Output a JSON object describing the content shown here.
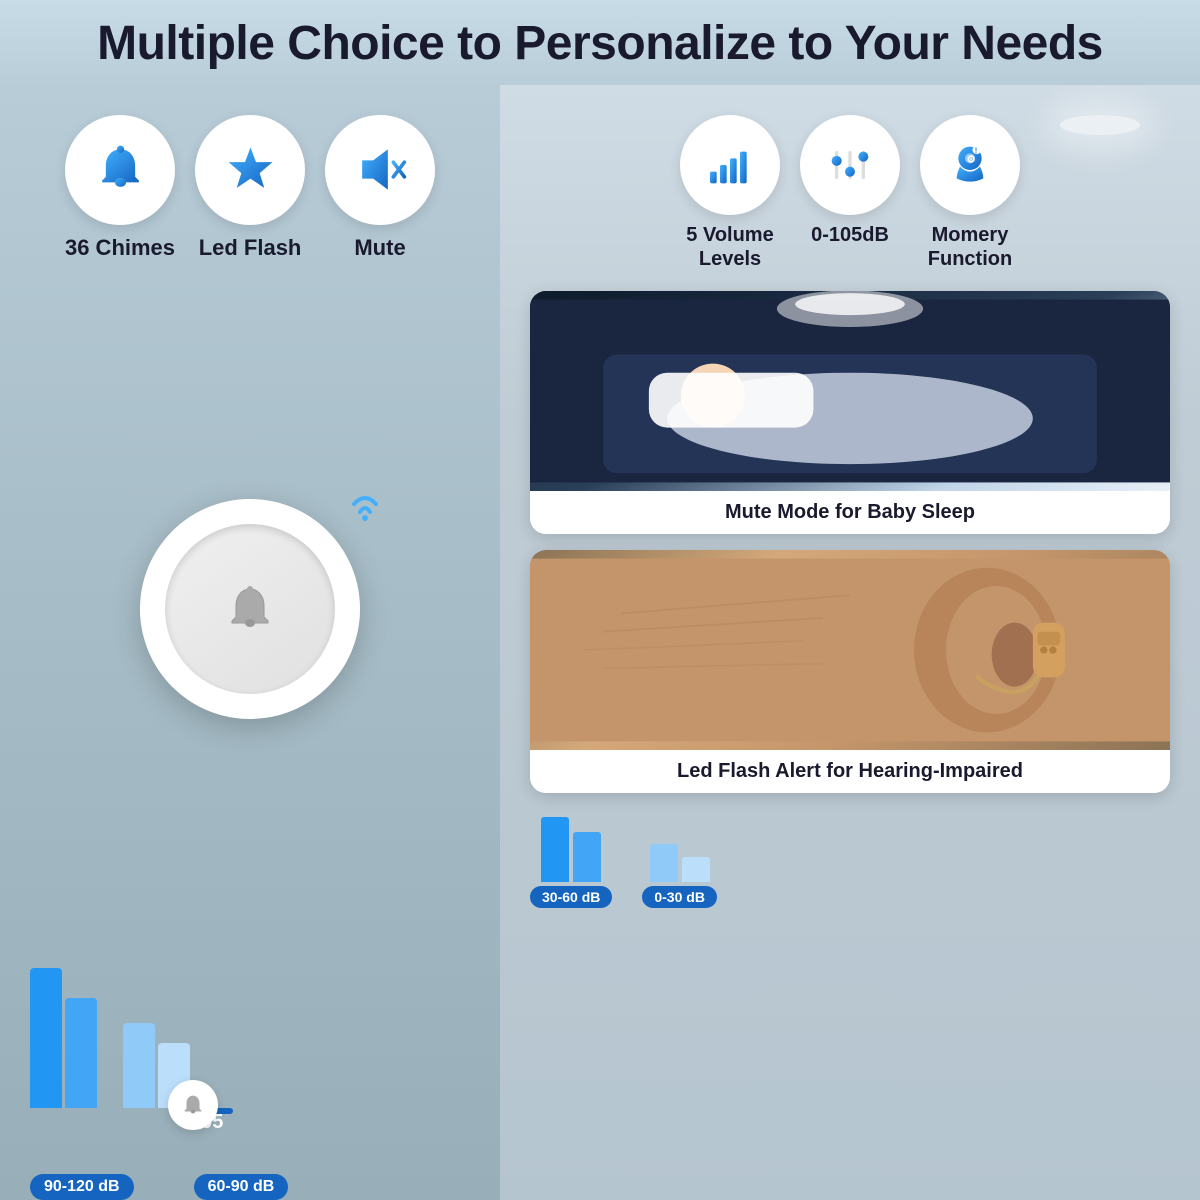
{
  "header": {
    "title": "Multiple Choice to Personalize to Your Needs"
  },
  "left_features": [
    {
      "id": "chimes",
      "label": "36 Chimes",
      "icon": "bell"
    },
    {
      "id": "led_flash",
      "label": "Led Flash",
      "icon": "star"
    },
    {
      "id": "mute",
      "label": "Mute",
      "icon": "mute"
    }
  ],
  "right_features": [
    {
      "id": "volume",
      "label": "5 Volume\nLevels",
      "icon": "bars"
    },
    {
      "id": "db",
      "label": "0-105dB",
      "icon": "equalizer"
    },
    {
      "id": "memory",
      "label": "Momery\nFunction",
      "icon": "head"
    }
  ],
  "db_badge": "105",
  "cards": [
    {
      "id": "baby",
      "label": "Mute Mode for Baby Sleep"
    },
    {
      "id": "ear",
      "label": "Led Flash Alert for Hearing-Impaired"
    }
  ],
  "volume_ranges_left": [
    {
      "label": "90-120 dB"
    },
    {
      "label": "60-90 dB"
    }
  ],
  "volume_ranges_right": [
    {
      "label": "30-60 dB"
    },
    {
      "label": "0-30 dB"
    }
  ]
}
